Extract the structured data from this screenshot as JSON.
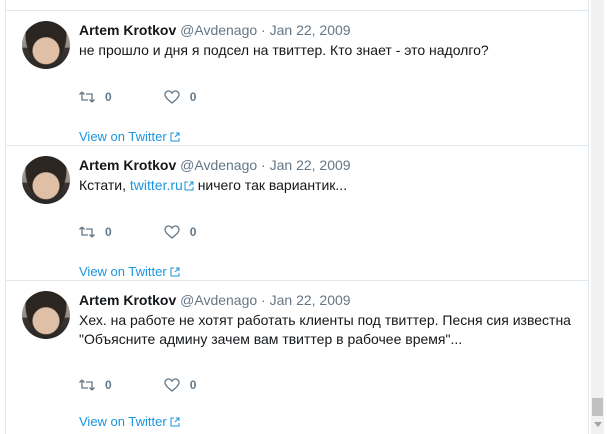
{
  "tweets": [
    {
      "author_name": "Artem Krotkov",
      "handle": "@Avdenago",
      "separator": "·",
      "date": "Jan 22, 2009",
      "text_before": "не прошло и дня я подсел на твиттер. Кто знает - это надолго?",
      "link_text": "",
      "text_after": "",
      "retweets": "0",
      "likes": "0",
      "view_link": "View on Twitter"
    },
    {
      "author_name": "Artem Krotkov",
      "handle": "@Avdenago",
      "separator": "·",
      "date": "Jan 22, 2009",
      "text_before": "Кстати, ",
      "link_text": "twitter.ru",
      "text_after": " ничего так вариантик...",
      "retweets": "0",
      "likes": "0",
      "view_link": "View on Twitter"
    },
    {
      "author_name": "Artem Krotkov",
      "handle": "@Avdenago",
      "separator": "·",
      "date": "Jan 22, 2009",
      "text_before": "Хех. на работе не хотят работать клиенты под твиттер. Песня сия известна \"Объясните админу зачем вам твиттер в рабочее время\"...",
      "link_text": "",
      "text_after": "",
      "retweets": "0",
      "likes": "0",
      "view_link": "View on Twitter"
    }
  ],
  "colors": {
    "link": "#1b95e0",
    "muted": "#657786",
    "divider": "#e1e8ed"
  },
  "icons": {
    "retweet": "retweet-icon",
    "like": "heart-icon",
    "external": "external-link-icon"
  }
}
